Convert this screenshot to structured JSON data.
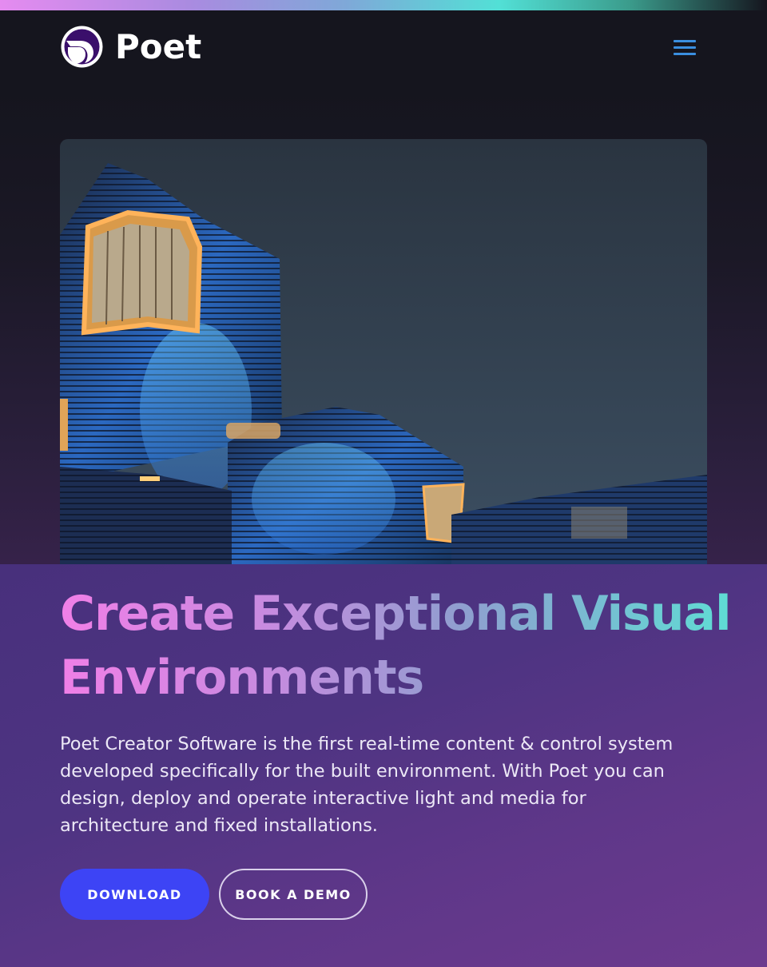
{
  "header": {
    "brand_name": "Poet",
    "logo_icon": "poet-logo-icon",
    "menu_icon": "hamburger-menu-icon"
  },
  "hero": {
    "image_alt": "Illuminated building with blue facade lighting at dusk",
    "headline_line1": "Create Exceptional Visual",
    "headline_line2": "Environments",
    "description": "Poet Creator Software is the first real-time content & control system developed specifically for the built environment. With Poet you can design, deploy and operate interactive light and media for architecture and fixed installations.",
    "buttons": {
      "download": "DOWNLOAD",
      "demo": "BOOK A DEMO"
    }
  },
  "colors": {
    "background": "#15151e",
    "accent_blue": "#3d44f5",
    "menu_blue": "#3a8fe0",
    "gradient_pink": "#f07fe7",
    "gradient_teal": "#5fdcd4",
    "panel_purple": "#4e3482"
  }
}
